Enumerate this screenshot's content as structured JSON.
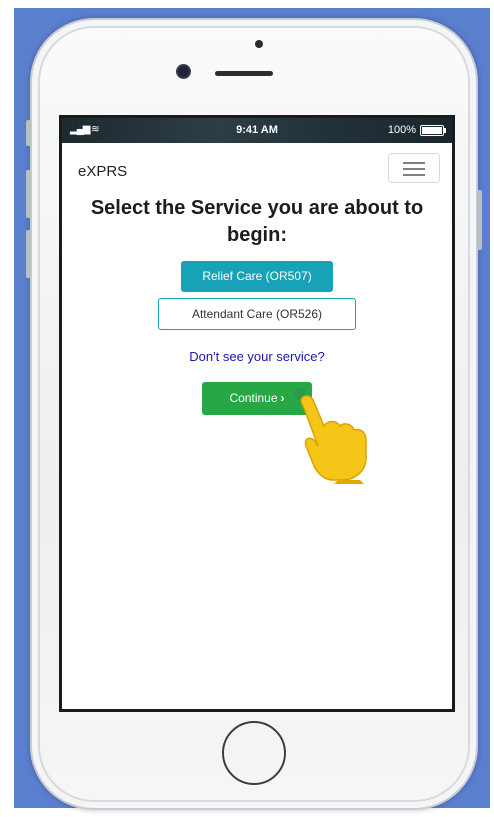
{
  "status_bar": {
    "signal": "▂▄▆",
    "wifi": "≋",
    "time": "9:41 AM",
    "battery": "100%"
  },
  "app": {
    "brand": "eXPRS",
    "menu_icon": "hamburger-menu-icon"
  },
  "page": {
    "heading": "Select the Service you are about to begin:",
    "services": [
      {
        "label": "Relief Care (OR507)",
        "selected": true
      },
      {
        "label": "Attendant Care (OR526)",
        "selected": false
      }
    ],
    "missing_service_link": "Don't see your service?",
    "continue_label": "Continue",
    "continue_icon": "chevron-right-icon"
  },
  "decoration": {
    "pointer": "pointing-hand-icon"
  },
  "colors": {
    "backdrop": "#5b7fcf",
    "primary_teal": "#17a2b8",
    "continue_green": "#28a745",
    "link_blue": "#1a14b8",
    "hand_yellow": "#f5c518"
  }
}
